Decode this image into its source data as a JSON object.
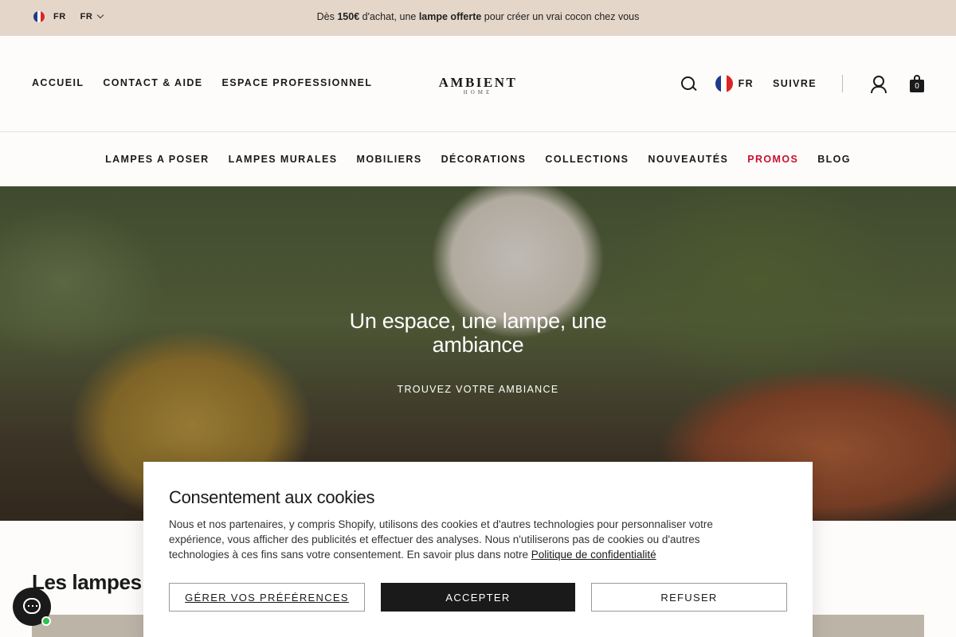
{
  "topbar": {
    "lang_code": "FR",
    "lang_select": "FR",
    "announce_pre": "Dès ",
    "announce_amount": "150€",
    "announce_mid": " d'achat, une ",
    "announce_gift": "lampe offerte",
    "announce_post": " pour créer un vrai cocon chez vous"
  },
  "header": {
    "nav_left": [
      "ACCUEIL",
      "CONTACT & AIDE",
      "ESPACE PROFESSIONNEL"
    ],
    "logo_main": "AMBIENT",
    "logo_sub": "HOME",
    "lang_label": "FR",
    "follow_label": "SUIVRE",
    "cart_count": "0"
  },
  "main_nav": {
    "items": [
      "LAMPES A POSER",
      "LAMPES MURALES",
      "MOBILIERS",
      "DÉCORATIONS",
      "COLLECTIONS",
      "NOUVEAUTÉS",
      "PROMOS",
      "BLOG"
    ],
    "highlight_color": "#c8102e"
  },
  "hero": {
    "title": "Un espace, une lampe, une ambiance",
    "cta": "TROUVEZ VOTRE AMBIANCE"
  },
  "section": {
    "title": "Les lampes le"
  },
  "cookie": {
    "title": "Consentement aux cookies",
    "body": "Nous et nos partenaires, y compris Shopify, utilisons des cookies et d'autres technologies pour personnaliser votre expérience, vous afficher des publicités et effectuer des analyses. Nous n'utiliserons pas de cookies ou d'autres technologies à ces fins sans votre consentement. En savoir plus dans notre ",
    "policy_link": "Politique de confidentialité",
    "btn_preferences": "GÉRER VOS PRÉFÉRENCES",
    "btn_accept": "ACCEPTER",
    "btn_refuse": "REFUSER"
  },
  "icons": {
    "flag": "flag-fr-icon",
    "search": "search-icon",
    "user": "user-icon",
    "cart": "shopping-bag-icon",
    "chat": "chat-icon"
  }
}
